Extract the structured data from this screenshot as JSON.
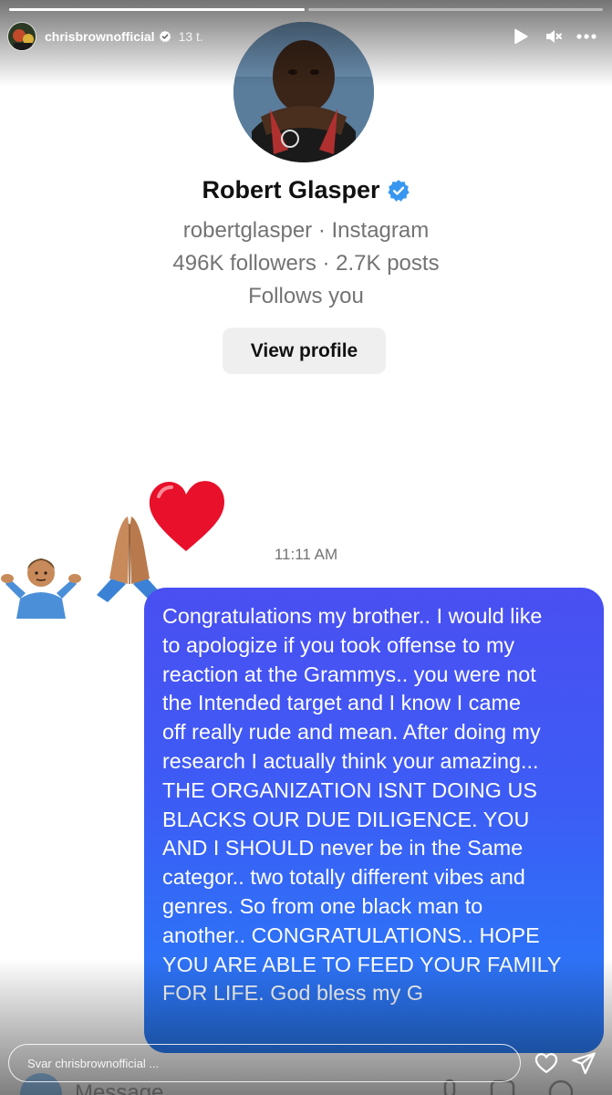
{
  "story": {
    "username": "chrisbrownofficial",
    "time_ago": "13 t.",
    "progress": [
      1.0,
      0.0
    ],
    "icons": [
      "play-icon",
      "mute-icon",
      "more-options-icon"
    ]
  },
  "profile_card": {
    "name": "Robert Glasper",
    "handle_line": "robertglasper · Instagram",
    "stats_line": "496K followers · 2.7K posts",
    "relation": "Follows you",
    "view_profile_label": "View profile"
  },
  "stickers": [
    "person-shrugging-emoji",
    "folded-hands-emoji",
    "red-heart-emoji"
  ],
  "message": {
    "timestamp": "11:11 AM",
    "lines": [
      "Congratulations my brother.. I would like",
      "to apologize if you took offense to my",
      "reaction at the Grammys.. you were not",
      "the Intended target and I know I came",
      "off really rude and mean. After doing my",
      "research I actually think your amazing...",
      "THE ORGANIZATION ISNT DOING US",
      "BLACKS OUR DUE DILIGENCE. YOU",
      "AND I SHOULD never be in the Same",
      "categor.. two totally different vibes and",
      "genres. So from one black man to",
      "another.. CONGRATULATIONS.. HOPE",
      "YOU ARE ABLE TO FEED YOUR FAMILY",
      "FOR LIFE. God bless my G"
    ],
    "colors": {
      "bubble_top": "#4a4ff2",
      "bubble_bottom": "#2a7cf6"
    }
  },
  "composer": {
    "placeholder": "Message"
  },
  "reply": {
    "placeholder": "Svar chrisbrownofficial ...",
    "icons": [
      "heart-outline-icon",
      "send-icon"
    ]
  }
}
